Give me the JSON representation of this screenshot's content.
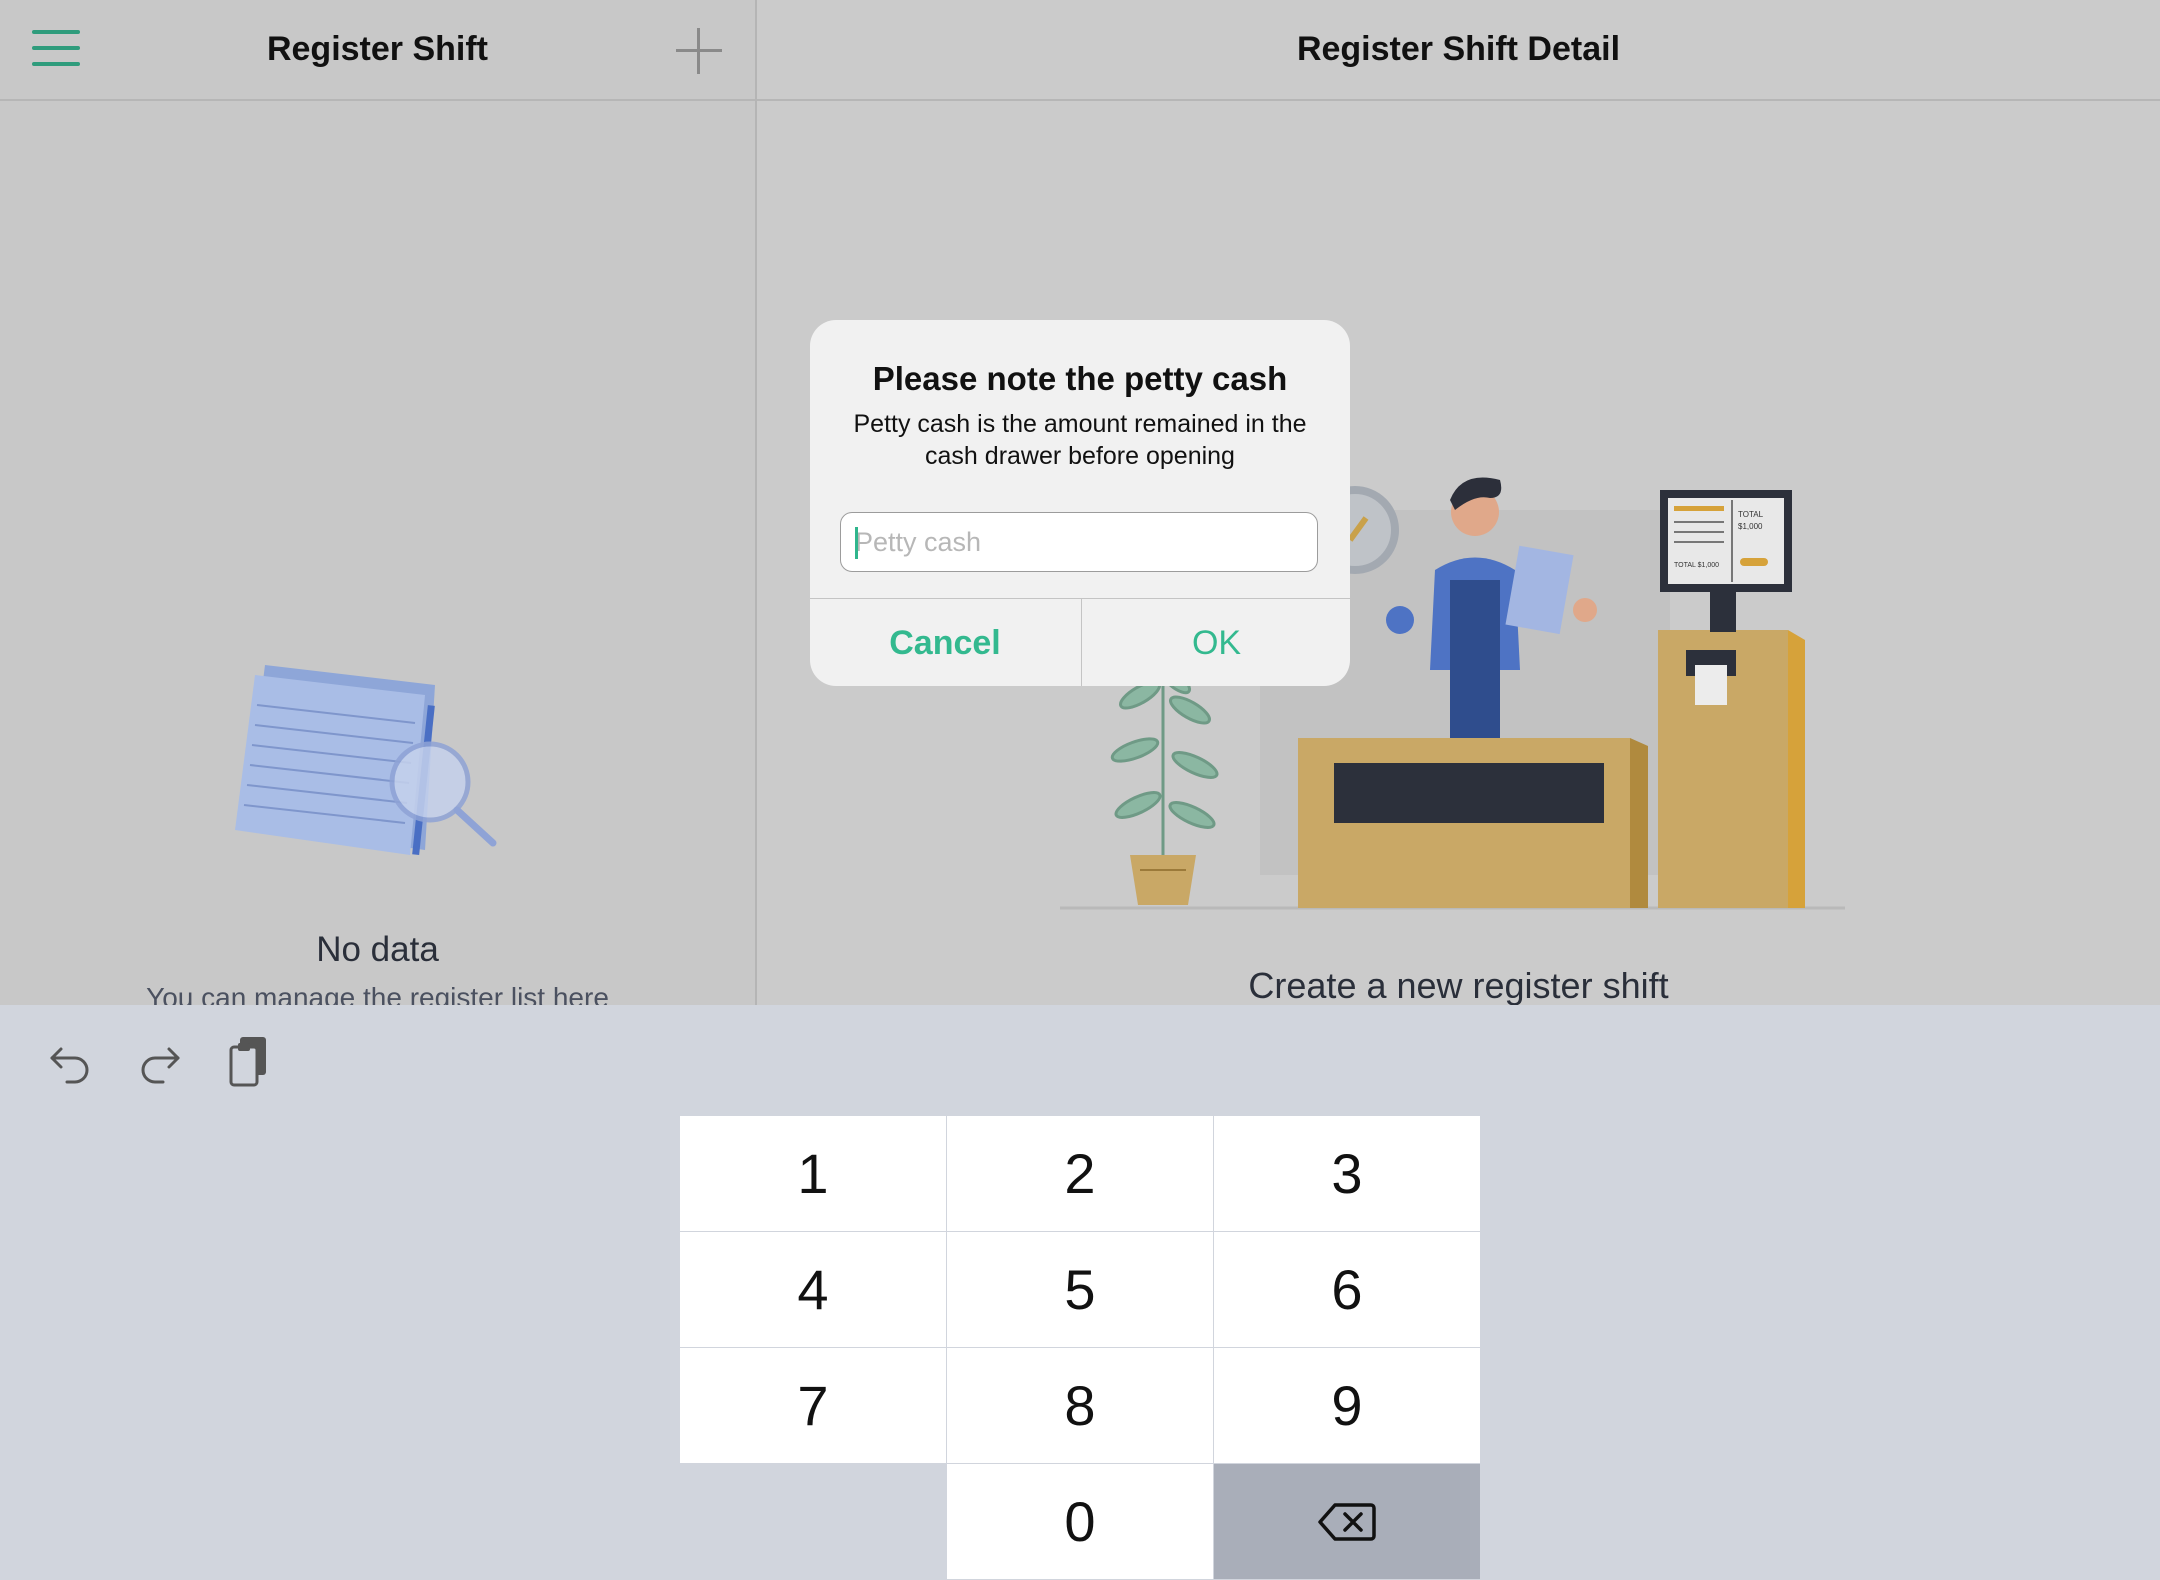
{
  "left_pane": {
    "title": "Register Shift",
    "empty_title": "No data",
    "empty_subtitle": "You can manage the register list here"
  },
  "right_pane": {
    "title": "Register Shift Detail",
    "create_prompt": "Create a new register shift"
  },
  "dialog": {
    "title": "Please note the petty cash",
    "message": "Petty cash is the amount remained in the cash drawer before opening",
    "input_placeholder": "Petty cash",
    "input_value": "",
    "cancel_label": "Cancel",
    "ok_label": "OK"
  },
  "keyboard": {
    "keys": [
      "1",
      "2",
      "3",
      "4",
      "5",
      "6",
      "7",
      "8",
      "9",
      "0"
    ]
  },
  "illustration_text": {
    "screen_total_1": "TOTAL",
    "screen_total_2": "$1,000",
    "screen_total_3": "TOTAL  $1,000"
  },
  "colors": {
    "accent": "#33b98f",
    "menu_icon": "#2f9c7c",
    "keyboard_bg": "#d1d5dd",
    "delete_key_bg": "#a9aeb9"
  }
}
